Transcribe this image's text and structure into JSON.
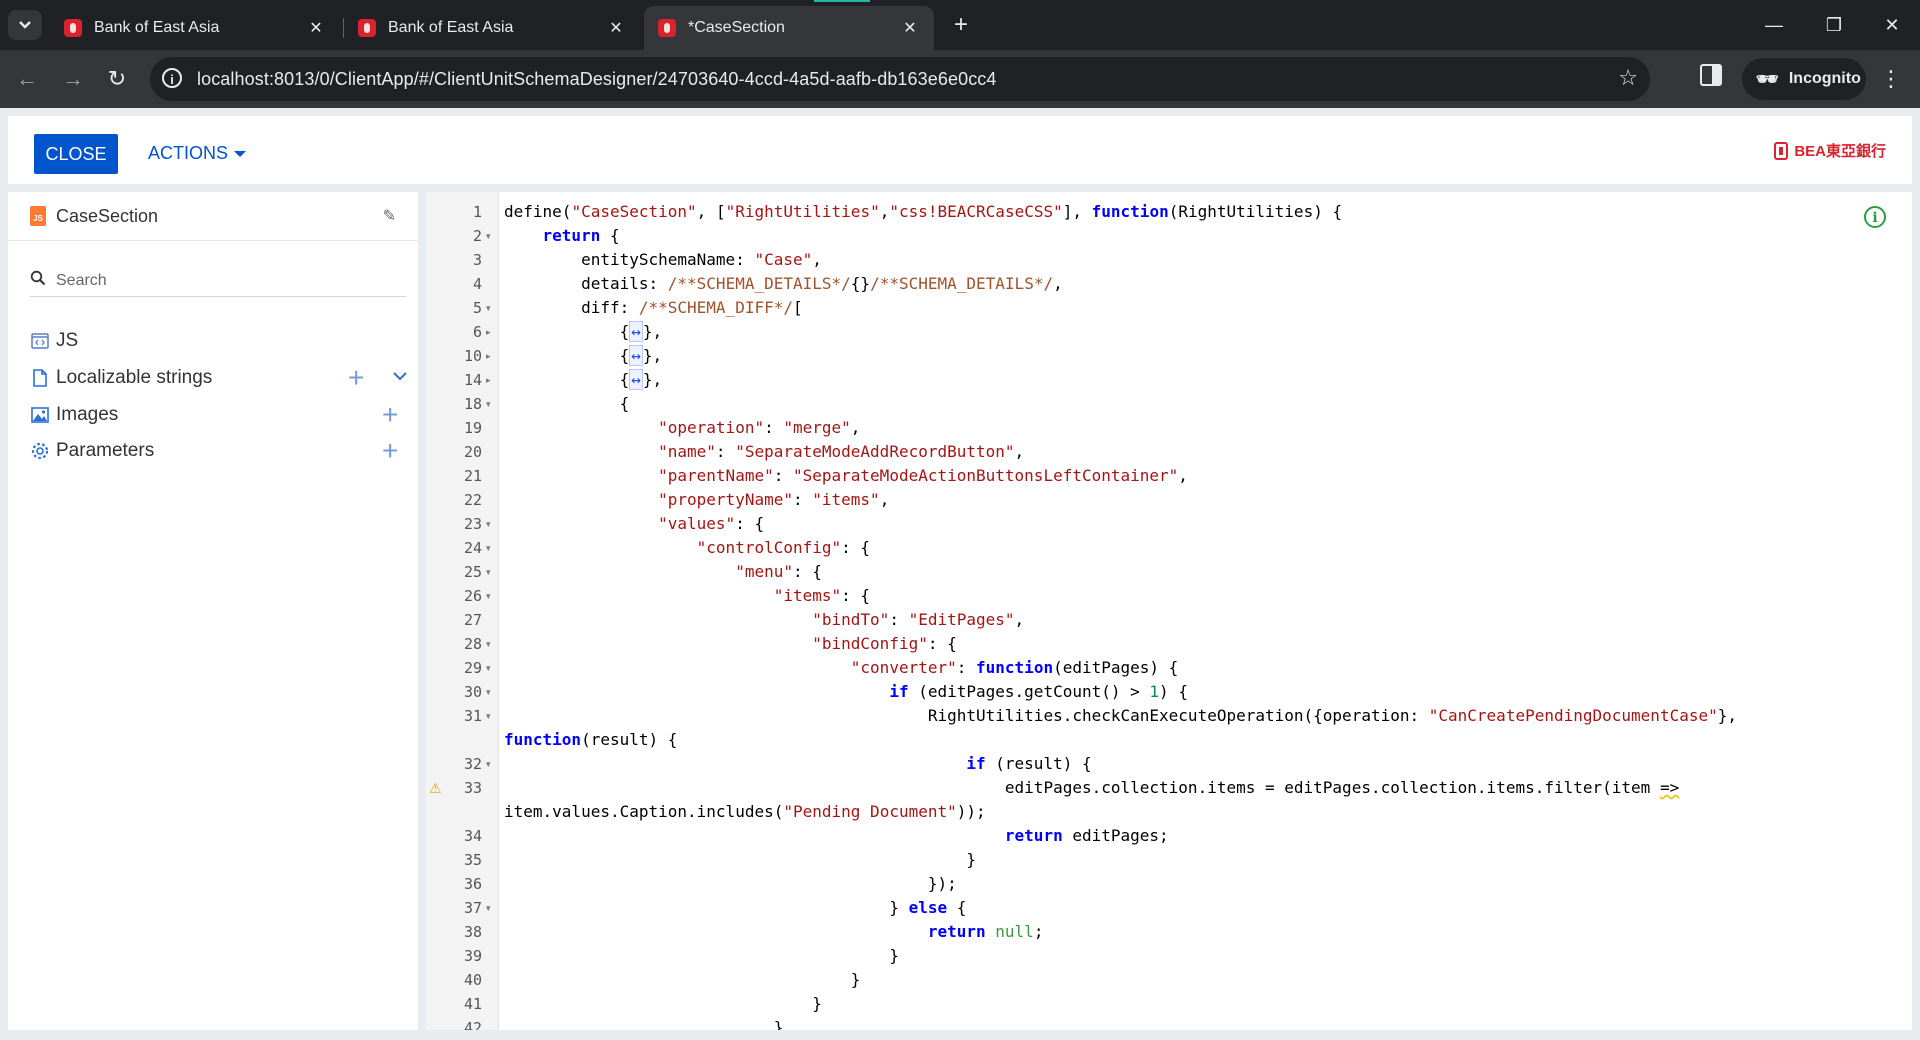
{
  "browser": {
    "tabs": [
      {
        "title": "Bank of East Asia",
        "active": false
      },
      {
        "title": "Bank of East Asia",
        "active": false
      },
      {
        "title": "*CaseSection",
        "active": true
      }
    ],
    "url": "localhost:8013/0/ClientApp/#/ClientUnitSchemaDesigner/24703640-4ccd-4a5d-aafb-db163e6e0cc4",
    "incognito_label": "Incognito",
    "icons": {
      "back": "back-arrow-icon",
      "forward": "forward-arrow-icon",
      "reload": "reload-icon",
      "star": "star-icon",
      "close": "close-icon",
      "new_tab": "plus-icon"
    }
  },
  "header": {
    "close_label": "CLOSE",
    "actions_label": "ACTIONS",
    "logo_text": "BEA東亞銀行"
  },
  "sidebar": {
    "schema_name": "CaseSection",
    "search_placeholder": "Search",
    "items": [
      {
        "label": "JS"
      },
      {
        "label": "Localizable strings"
      },
      {
        "label": "Images"
      },
      {
        "label": "Parameters"
      }
    ]
  },
  "colors": {
    "primary": "#0054cc",
    "brand": "#d9232e",
    "keyword": "#0000ff",
    "string": "#a31515",
    "comment": "#a0522d",
    "warning": "#e8a700",
    "info": "#2e9b45"
  },
  "editor": {
    "lines": [
      {
        "n": "1",
        "fold": false,
        "warn": false
      },
      {
        "n": "2",
        "fold": true,
        "warn": false
      },
      {
        "n": "3",
        "fold": false,
        "warn": false
      },
      {
        "n": "4",
        "fold": false,
        "warn": false
      },
      {
        "n": "5",
        "fold": true,
        "warn": false
      },
      {
        "n": "6",
        "fold": "collapsed",
        "warn": false
      },
      {
        "n": "10",
        "fold": "collapsed",
        "warn": false
      },
      {
        "n": "14",
        "fold": "collapsed",
        "warn": false
      },
      {
        "n": "18",
        "fold": true,
        "warn": false
      },
      {
        "n": "19",
        "fold": false,
        "warn": false
      },
      {
        "n": "20",
        "fold": false,
        "warn": false
      },
      {
        "n": "21",
        "fold": false,
        "warn": false
      },
      {
        "n": "22",
        "fold": false,
        "warn": false
      },
      {
        "n": "23",
        "fold": true,
        "warn": false
      },
      {
        "n": "24",
        "fold": true,
        "warn": false
      },
      {
        "n": "25",
        "fold": true,
        "warn": false
      },
      {
        "n": "26",
        "fold": true,
        "warn": false
      },
      {
        "n": "27",
        "fold": false,
        "warn": false
      },
      {
        "n": "28",
        "fold": true,
        "warn": false
      },
      {
        "n": "29",
        "fold": true,
        "warn": false
      },
      {
        "n": "30",
        "fold": true,
        "warn": false
      },
      {
        "n": "31",
        "fold": true,
        "warn": false
      },
      {
        "n": "",
        "fold": false,
        "warn": false
      },
      {
        "n": "32",
        "fold": true,
        "warn": false
      },
      {
        "n": "33",
        "fold": false,
        "warn": true
      },
      {
        "n": "",
        "fold": false,
        "warn": false
      },
      {
        "n": "34",
        "fold": false,
        "warn": false
      },
      {
        "n": "35",
        "fold": false,
        "warn": false
      },
      {
        "n": "36",
        "fold": false,
        "warn": false
      },
      {
        "n": "37",
        "fold": true,
        "warn": false
      },
      {
        "n": "38",
        "fold": false,
        "warn": false
      },
      {
        "n": "39",
        "fold": false,
        "warn": false
      },
      {
        "n": "40",
        "fold": false,
        "warn": false
      },
      {
        "n": "41",
        "fold": false,
        "warn": false
      },
      {
        "n": "42",
        "fold": false,
        "warn": false
      }
    ],
    "code": [
      [
        [
          "",
          "define("
        ],
        [
          "str",
          "\"CaseSection\""
        ],
        [
          "",
          ", ["
        ],
        [
          "str",
          "\"RightUtilities\""
        ],
        [
          "",
          ","
        ],
        [
          "str",
          "\"css!BEACRCaseCSS\""
        ],
        [
          "",
          "], "
        ],
        [
          "kw",
          "function"
        ],
        [
          "",
          "(RightUtilities) {"
        ]
      ],
      [
        [
          "",
          "    "
        ],
        [
          "kw",
          "return"
        ],
        [
          "",
          " {"
        ]
      ],
      [
        [
          "",
          "        entitySchemaName: "
        ],
        [
          "str",
          "\"Case\""
        ],
        [
          "",
          ","
        ]
      ],
      [
        [
          "",
          "        details: "
        ],
        [
          "cm",
          "/**SCHEMA_DETAILS*/"
        ],
        [
          "",
          "{}"
        ],
        [
          "cm",
          "/**SCHEMA_DETAILS*/"
        ],
        [
          "",
          ","
        ]
      ],
      [
        [
          "",
          "        diff: "
        ],
        [
          "cm",
          "/**SCHEMA_DIFF*/"
        ],
        [
          "",
          "["
        ]
      ],
      [
        [
          "",
          "            {"
        ],
        [
          "arrow",
          "↔"
        ],
        [
          "",
          "},"
        ]
      ],
      [
        [
          "",
          "            {"
        ],
        [
          "arrow",
          "↔"
        ],
        [
          "",
          "},"
        ]
      ],
      [
        [
          "",
          "            {"
        ],
        [
          "arrow",
          "↔"
        ],
        [
          "",
          "},"
        ]
      ],
      [
        [
          "",
          "            {"
        ]
      ],
      [
        [
          "",
          "                "
        ],
        [
          "str",
          "\"operation\""
        ],
        [
          "",
          ": "
        ],
        [
          "str",
          "\"merge\""
        ],
        [
          "",
          ","
        ]
      ],
      [
        [
          "",
          "                "
        ],
        [
          "str",
          "\"name\""
        ],
        [
          "",
          ": "
        ],
        [
          "str",
          "\"SeparateModeAddRecordButton\""
        ],
        [
          "",
          ","
        ]
      ],
      [
        [
          "",
          "                "
        ],
        [
          "str",
          "\"parentName\""
        ],
        [
          "",
          ": "
        ],
        [
          "str",
          "\"SeparateModeActionButtonsLeftContainer\""
        ],
        [
          "",
          ","
        ]
      ],
      [
        [
          "",
          "                "
        ],
        [
          "str",
          "\"propertyName\""
        ],
        [
          "",
          ": "
        ],
        [
          "str",
          "\"items\""
        ],
        [
          "",
          ","
        ]
      ],
      [
        [
          "",
          "                "
        ],
        [
          "str",
          "\"values\""
        ],
        [
          "",
          ": {"
        ]
      ],
      [
        [
          "",
          "                    "
        ],
        [
          "str",
          "\"controlConfig\""
        ],
        [
          "",
          ": {"
        ]
      ],
      [
        [
          "",
          "                        "
        ],
        [
          "str",
          "\"menu\""
        ],
        [
          "",
          ": {"
        ]
      ],
      [
        [
          "",
          "                            "
        ],
        [
          "str",
          "\"items\""
        ],
        [
          "",
          ": {"
        ]
      ],
      [
        [
          "",
          "                                "
        ],
        [
          "str",
          "\"bindTo\""
        ],
        [
          "",
          ": "
        ],
        [
          "str",
          "\"EditPages\""
        ],
        [
          "",
          ","
        ]
      ],
      [
        [
          "",
          "                                "
        ],
        [
          "str",
          "\"bindConfig\""
        ],
        [
          "",
          ": {"
        ]
      ],
      [
        [
          "",
          "                                    "
        ],
        [
          "str",
          "\"converter\""
        ],
        [
          "",
          ": "
        ],
        [
          "kw",
          "function"
        ],
        [
          "",
          "(editPages) {"
        ]
      ],
      [
        [
          "",
          "                                        "
        ],
        [
          "kw",
          "if"
        ],
        [
          "",
          " (editPages.getCount() > "
        ],
        [
          "num",
          "1"
        ],
        [
          "",
          ") {"
        ]
      ],
      [
        [
          "",
          "                                            RightUtilities.checkCanExecuteOperation({operation: "
        ],
        [
          "str",
          "\"CanCreatePendingDocumentCase\""
        ],
        [
          "",
          "},"
        ]
      ],
      [
        [
          "kw",
          "function"
        ],
        [
          "",
          "(result) {"
        ]
      ],
      [
        [
          "",
          "                                                "
        ],
        [
          "kw",
          "if"
        ],
        [
          "",
          " (result) {"
        ]
      ],
      [
        [
          "",
          "                                                    editPages.collection.items = editPages.collection.items.filter(item "
        ],
        [
          "sq",
          "=>"
        ]
      ],
      [
        [
          "",
          "item.values.Caption.includes("
        ],
        [
          "str",
          "\"Pending Document\""
        ],
        [
          "",
          "));"
        ]
      ],
      [
        [
          "",
          "                                                    "
        ],
        [
          "kw",
          "return"
        ],
        [
          "",
          " editPages;"
        ]
      ],
      [
        [
          "",
          "                                                }"
        ]
      ],
      [
        [
          "",
          "                                            });"
        ]
      ],
      [
        [
          "",
          "                                        } "
        ],
        [
          "kw",
          "else"
        ],
        [
          "",
          " {"
        ]
      ],
      [
        [
          "",
          "                                            "
        ],
        [
          "kw",
          "return"
        ],
        [
          "",
          " "
        ],
        [
          "nul",
          "null"
        ],
        [
          "",
          ";"
        ]
      ],
      [
        [
          "",
          "                                        }"
        ]
      ],
      [
        [
          "",
          "                                    }"
        ]
      ],
      [
        [
          "",
          "                                }"
        ]
      ],
      [
        [
          "",
          "                            }"
        ]
      ]
    ]
  }
}
